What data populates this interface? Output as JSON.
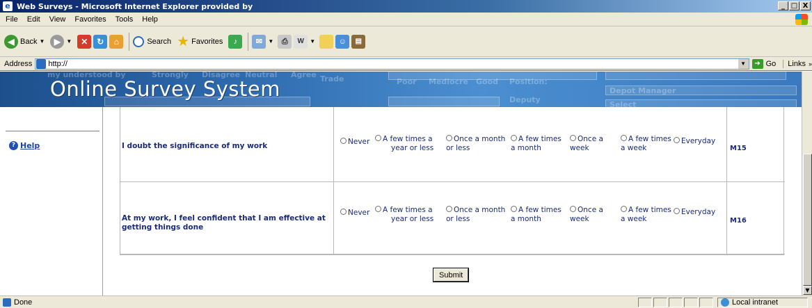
{
  "window": {
    "title": "Web Surveys - Microsoft Internet Explorer provided by",
    "buttons": {
      "minimize": "_",
      "maximize": "□",
      "close": "X"
    }
  },
  "menu": [
    "File",
    "Edit",
    "View",
    "Favorites",
    "Tools",
    "Help"
  ],
  "toolbar": {
    "back_label": "Back",
    "search_label": "Search",
    "favorites_label": "Favorites"
  },
  "address": {
    "label": "Address",
    "value": "http://",
    "go_label": "Go",
    "links_label": "Links"
  },
  "banner": {
    "title": "Online Survey System",
    "background_ghost_text": [
      "Strongly",
      "Disagree",
      "Neutral",
      "Agree",
      "Poor",
      "Mediocre",
      "Good",
      "Trade",
      "Position:",
      "Depot Manager",
      "Select",
      "Deputy"
    ]
  },
  "sidebar": {
    "help_label": "Help"
  },
  "survey": {
    "options": [
      {
        "line1": "Never",
        "line2": ""
      },
      {
        "line1": "A few times a",
        "line2": "year or less"
      },
      {
        "line1": "Once a month",
        "line2": "or less"
      },
      {
        "line1": "A few times",
        "line2": "a month"
      },
      {
        "line1": "Once a",
        "line2": "week"
      },
      {
        "line1": "A few times",
        "line2": "a week"
      },
      {
        "line1": "Everyday",
        "line2": ""
      }
    ],
    "questions": [
      {
        "text": "I doubt the significance of my work",
        "code": "M15"
      },
      {
        "text": "At my work, I feel confident that I am effective at getting things done",
        "code": "M16"
      }
    ],
    "submit_label": "Submit"
  },
  "status": {
    "text": "Done",
    "zone": "Local intranet"
  },
  "colors": {
    "titlebar": "#0a246a",
    "question_text": "#1a2a7a",
    "banner": "#2e6aae",
    "link": "#2241a8"
  }
}
